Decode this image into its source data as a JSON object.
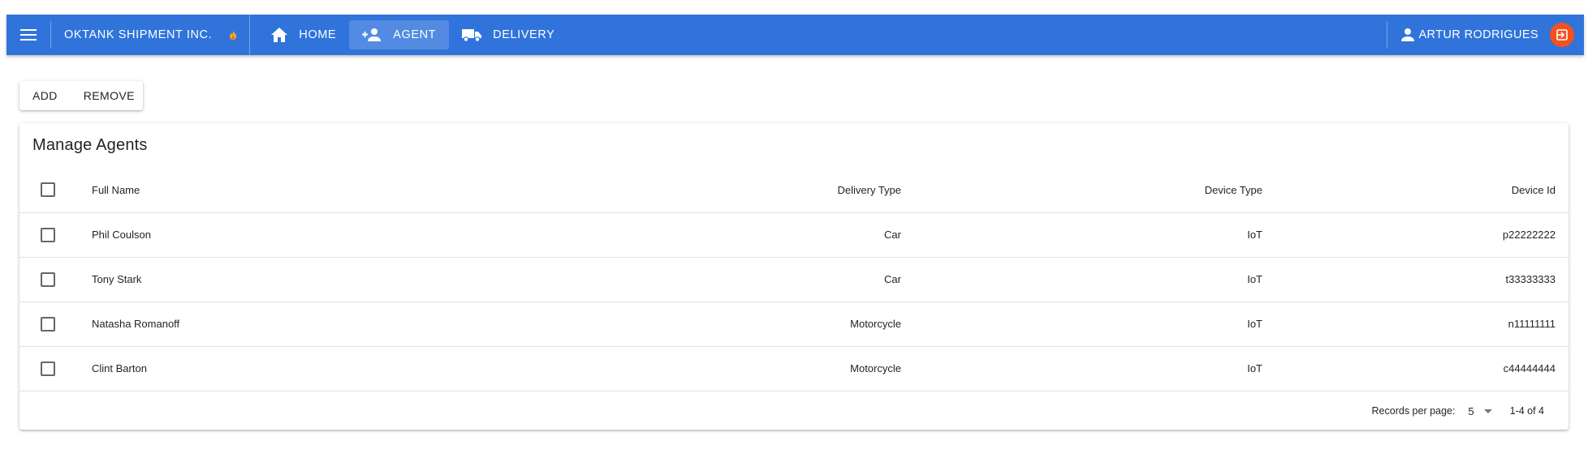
{
  "appbar": {
    "brand": "OKTANK SHIPMENT INC.",
    "nav": [
      {
        "label": "HOME",
        "icon": "home-icon"
      },
      {
        "label": "AGENT",
        "icon": "person-add-icon",
        "active": true
      },
      {
        "label": "DELIVERY",
        "icon": "truck-icon"
      }
    ],
    "user_name": "ARTUR RODRIGUES",
    "logout_icon": "logout-icon"
  },
  "toolbar": {
    "add_label": "ADD",
    "remove_label": "REMOVE"
  },
  "card": {
    "title": "Manage Agents"
  },
  "table": {
    "columns": [
      "Full Name",
      "Delivery Type",
      "Device Type",
      "Device Id"
    ],
    "rows": [
      [
        "Phil Coulson",
        "Car",
        "IoT",
        "p22222222"
      ],
      [
        "Tony Stark",
        "Car",
        "IoT",
        "t33333333"
      ],
      [
        "Natasha Romanoff",
        "Motorcycle",
        "IoT",
        "n11111111"
      ],
      [
        "Clint Barton",
        "Motorcycle",
        "IoT",
        "c44444444"
      ]
    ]
  },
  "pagination": {
    "records_per_page_label": "Records per page:",
    "records_per_page_value": "5",
    "range_text": "1-4 of 4"
  },
  "colors": {
    "appbar": "#3074db",
    "logout_button": "#f4511e",
    "flame": "#f9a825"
  }
}
